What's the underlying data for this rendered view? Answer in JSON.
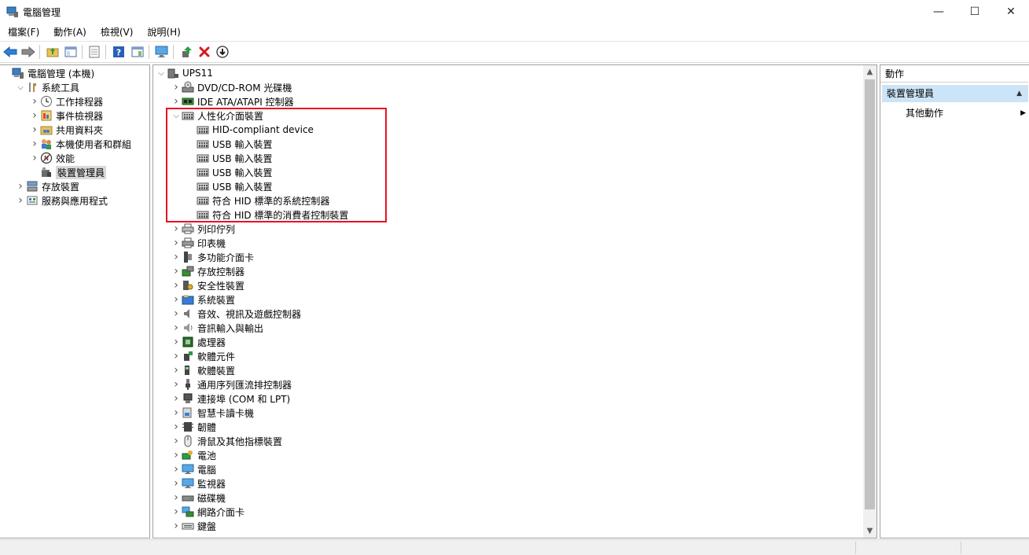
{
  "window": {
    "title": "電腦管理",
    "minimize": "—",
    "maximize": "☐",
    "close": "✕"
  },
  "menu": [
    "檔案(F)",
    "動作(A)",
    "檢視(V)",
    "說明(H)"
  ],
  "left_tree": [
    {
      "label": "電腦管理 (本機)",
      "level": 0,
      "arrow": "",
      "icon": "computer-management-icon"
    },
    {
      "label": "系統工具",
      "level": 1,
      "arrow": "⌄",
      "icon": "system-tools-icon"
    },
    {
      "label": "工作排程器",
      "level": 2,
      "arrow": "›",
      "icon": "clock-icon"
    },
    {
      "label": "事件檢視器",
      "level": 2,
      "arrow": "›",
      "icon": "event-viewer-icon"
    },
    {
      "label": "共用資料夾",
      "level": 2,
      "arrow": "›",
      "icon": "shared-folder-icon"
    },
    {
      "label": "本機使用者和群組",
      "level": 2,
      "arrow": "›",
      "icon": "users-icon"
    },
    {
      "label": "效能",
      "level": 2,
      "arrow": "›",
      "icon": "performance-icon"
    },
    {
      "label": "裝置管理員",
      "level": 2,
      "arrow": "",
      "icon": "device-manager-icon",
      "selected": true
    },
    {
      "label": "存放裝置",
      "level": 1,
      "arrow": "›",
      "icon": "storage-icon"
    },
    {
      "label": "服務與應用程式",
      "level": 1,
      "arrow": "›",
      "icon": "services-icon"
    }
  ],
  "device_tree": [
    {
      "label": "UPS11",
      "level": 0,
      "arrow": "⌄",
      "icon": "computer-icon"
    },
    {
      "label": "DVD/CD-ROM 光碟機",
      "level": 1,
      "arrow": "›",
      "icon": "dvd-drive-icon"
    },
    {
      "label": "IDE ATA/ATAPI 控制器",
      "level": 1,
      "arrow": "›",
      "icon": "ide-controller-icon"
    },
    {
      "label": "人性化介面裝置",
      "level": 1,
      "arrow": "⌄",
      "icon": "hid-icon"
    },
    {
      "label": "HID-compliant device",
      "level": 2,
      "arrow": "",
      "icon": "hid-icon"
    },
    {
      "label": "USB 輸入裝置",
      "level": 2,
      "arrow": "",
      "icon": "hid-icon"
    },
    {
      "label": "USB 輸入裝置",
      "level": 2,
      "arrow": "",
      "icon": "hid-icon"
    },
    {
      "label": "USB 輸入裝置",
      "level": 2,
      "arrow": "",
      "icon": "hid-icon"
    },
    {
      "label": "USB 輸入裝置",
      "level": 2,
      "arrow": "",
      "icon": "hid-icon"
    },
    {
      "label": "符合 HID 標準的系統控制器",
      "level": 2,
      "arrow": "",
      "icon": "hid-icon"
    },
    {
      "label": "符合 HID 標準的消費者控制裝置",
      "level": 2,
      "arrow": "",
      "icon": "hid-icon"
    },
    {
      "label": "列印佇列",
      "level": 1,
      "arrow": "›",
      "icon": "print-queue-icon"
    },
    {
      "label": "印表機",
      "level": 1,
      "arrow": "›",
      "icon": "printer-icon"
    },
    {
      "label": "多功能介面卡",
      "level": 1,
      "arrow": "›",
      "icon": "multifunction-adapter-icon"
    },
    {
      "label": "存放控制器",
      "level": 1,
      "arrow": "›",
      "icon": "storage-controller-icon"
    },
    {
      "label": "安全性裝置",
      "level": 1,
      "arrow": "›",
      "icon": "security-device-icon"
    },
    {
      "label": "系統裝置",
      "level": 1,
      "arrow": "›",
      "icon": "system-devices-icon"
    },
    {
      "label": "音效、視訊及遊戲控制器",
      "level": 1,
      "arrow": "›",
      "icon": "sound-icon"
    },
    {
      "label": "音訊輸入與輸出",
      "level": 1,
      "arrow": "›",
      "icon": "audio-io-icon"
    },
    {
      "label": "處理器",
      "level": 1,
      "arrow": "›",
      "icon": "processor-icon"
    },
    {
      "label": "軟體元件",
      "level": 1,
      "arrow": "›",
      "icon": "software-component-icon"
    },
    {
      "label": "軟體裝置",
      "level": 1,
      "arrow": "›",
      "icon": "software-device-icon"
    },
    {
      "label": "通用序列匯流排控制器",
      "level": 1,
      "arrow": "›",
      "icon": "usb-controller-icon"
    },
    {
      "label": "連接埠 (COM 和 LPT)",
      "level": 1,
      "arrow": "›",
      "icon": "port-icon"
    },
    {
      "label": "智慧卡讀卡機",
      "level": 1,
      "arrow": "›",
      "icon": "smart-card-reader-icon"
    },
    {
      "label": "韌體",
      "level": 1,
      "arrow": "›",
      "icon": "firmware-icon"
    },
    {
      "label": "滑鼠及其他指標裝置",
      "level": 1,
      "arrow": "›",
      "icon": "mouse-icon"
    },
    {
      "label": "電池",
      "level": 1,
      "arrow": "›",
      "icon": "battery-icon"
    },
    {
      "label": "電腦",
      "level": 1,
      "arrow": "›",
      "icon": "monitor-icon"
    },
    {
      "label": "監視器",
      "level": 1,
      "arrow": "›",
      "icon": "monitor-icon"
    },
    {
      "label": "磁碟機",
      "level": 1,
      "arrow": "›",
      "icon": "disk-drive-icon"
    },
    {
      "label": "網路介面卡",
      "level": 1,
      "arrow": "›",
      "icon": "network-adapter-icon"
    },
    {
      "label": "鍵盤",
      "level": 1,
      "arrow": "›",
      "icon": "keyboard-icon"
    }
  ],
  "actions": {
    "header": "動作",
    "section": "裝置管理員",
    "item": "其他動作"
  },
  "colors": {
    "highlight_box": "#e81123",
    "selection": "#cce4f7"
  }
}
